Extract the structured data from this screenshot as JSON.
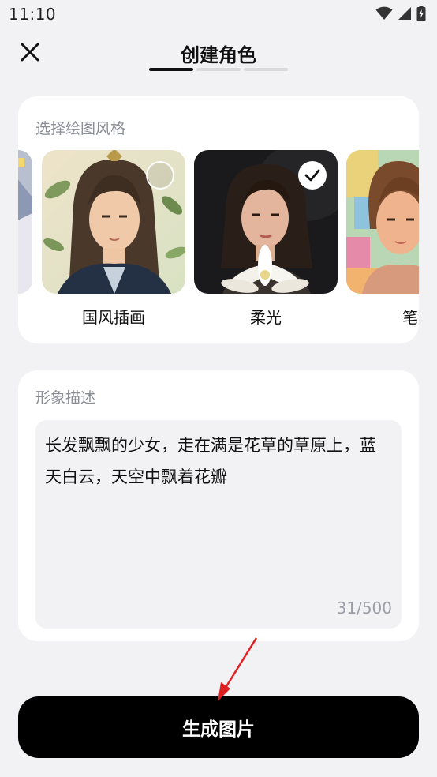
{
  "status_bar": {
    "time": "11:10"
  },
  "header": {
    "title": "创建角色",
    "steps_total": 3,
    "active_step": 1
  },
  "style_section": {
    "label": "选择绘图风格",
    "items": [
      {
        "name": "",
        "selected": false,
        "visible_fraction": 0.1
      },
      {
        "name": "国风插画",
        "selected": false
      },
      {
        "name": "柔光",
        "selected": true
      },
      {
        "name": "笔触",
        "selected": false
      }
    ]
  },
  "description": {
    "label": "形象描述",
    "text": "长发飘飘的少女，走在满是花草的草原上，蓝天白云，天空中飘着花瓣",
    "char_count": "31/500"
  },
  "generate_button": {
    "label": "生成图片"
  },
  "colors": {
    "accent": "#000000",
    "background": "#f2f2f5",
    "annotation_arrow": "#e02020"
  }
}
